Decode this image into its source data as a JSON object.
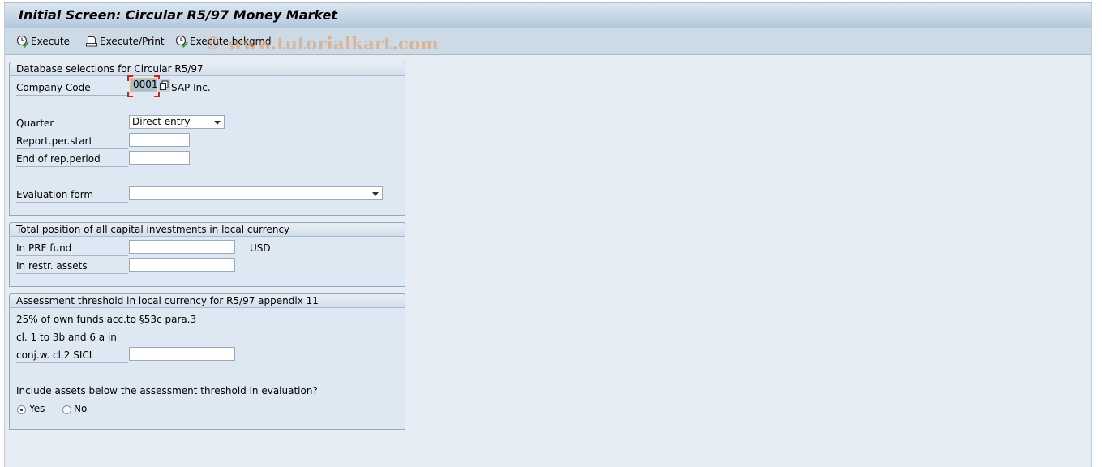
{
  "window": {
    "title": "Initial Screen: Circular R5/97 Money Market"
  },
  "toolbar": {
    "execute": "Execute",
    "execute_print": "Execute/Print",
    "execute_background": "Execute bckgrnd"
  },
  "watermark": "© www.tutorialkart.com",
  "db_selections": {
    "heading": "Database selections for Circular R5/97",
    "company_code_label": "Company Code",
    "company_code_value": "0001",
    "company_name": "SAP Inc.",
    "quarter_label": "Quarter",
    "quarter_value": "Direct entry",
    "report_start_label": "Report.per.start",
    "report_start_value": "",
    "report_end_label": "End of rep.period",
    "report_end_value": "",
    "evaluation_form_label": "Evaluation form",
    "evaluation_form_value": ""
  },
  "total_position": {
    "heading": "Total position of all capital investments in local currency",
    "prf_fund_label": "In PRF fund",
    "prf_fund_value": "",
    "currency": "USD",
    "restr_assets_label": "In restr. assets",
    "restr_assets_value": ""
  },
  "assessment": {
    "heading": "Assessment threshold in local currency for R5/97 appendix 11",
    "line1": "25% of own funds acc.to §53c para.3",
    "line2": "cl. 1 to 3b and 6 a in",
    "line3_label": "conj.w. cl.2 SICL",
    "line3_value": "",
    "question": "Include assets below the assessment threshold in evaluation?",
    "options": [
      {
        "label": "Yes",
        "selected": true
      },
      {
        "label": "No",
        "selected": false
      }
    ]
  }
}
